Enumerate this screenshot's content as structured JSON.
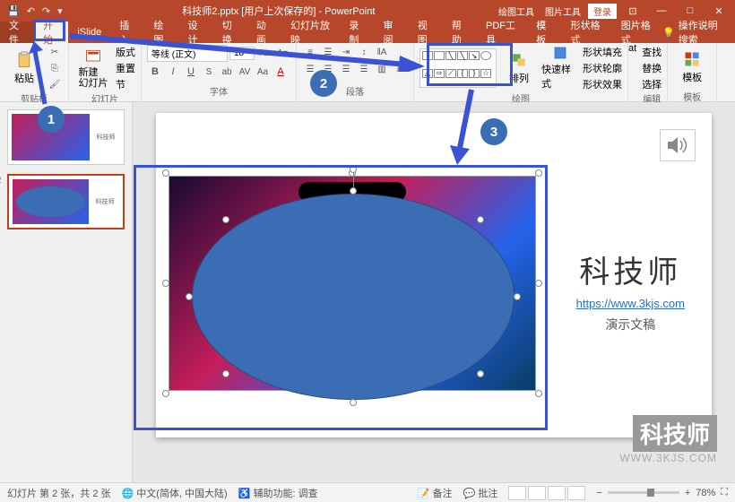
{
  "title": "科技师2.pptx [用户上次保存的] - PowerPoint",
  "title_tools": {
    "draw": "绘图工具",
    "pic": "图片工具",
    "login": "登录"
  },
  "menu": {
    "file": "文件",
    "home": "开始",
    "islide": "iSlide",
    "insert": "插入",
    "draw": "绘图",
    "design": "设计",
    "transitions": "切换",
    "animations": "动画",
    "slideshow": "幻灯片放映",
    "record": "录制",
    "review": "审阅",
    "view": "视图",
    "help": "帮助",
    "pdf": "PDF工具",
    "template": "模板",
    "shapefmt": "形状格式",
    "picfmt": "图片格式"
  },
  "tellme": "操作说明搜索",
  "ribbon": {
    "clipboard": {
      "label": "剪贴板",
      "paste": "粘贴"
    },
    "slides": {
      "label": "幻灯片",
      "new": "新建\n幻灯片",
      "layout": "版式",
      "reset": "重置",
      "section": "节"
    },
    "font": {
      "label": "字体",
      "name": "等线 (正文)",
      "size": "18"
    },
    "paragraph": {
      "label": "段落"
    },
    "drawing": {
      "label": "绘图",
      "arrange": "排列",
      "quickstyle": "快速样式",
      "fill": "形状填充",
      "outline": "形状轮廓",
      "effects": "形状效果"
    },
    "editing": {
      "label": "编辑",
      "find": "查找",
      "replace": "替换",
      "select": "选择"
    },
    "templates": {
      "label": "模板",
      "btn": "模板"
    }
  },
  "slide": {
    "title": "科技师",
    "url": "https://www.3kjs.com",
    "subtitle": "演示文稿"
  },
  "watermark": {
    "main": "科技师",
    "url": "WWW.3KJS.COM"
  },
  "thumb": {
    "label": "科技师"
  },
  "status": {
    "slide_info": "幻灯片 第 2 张，共 2 张",
    "lang": "中文(简体, 中国大陆)",
    "access": "辅助功能: 调查",
    "notes": "备注",
    "comments": "批注",
    "zoom": "78%"
  },
  "annotations": {
    "n1": "1",
    "n2": "2",
    "n3": "3"
  }
}
